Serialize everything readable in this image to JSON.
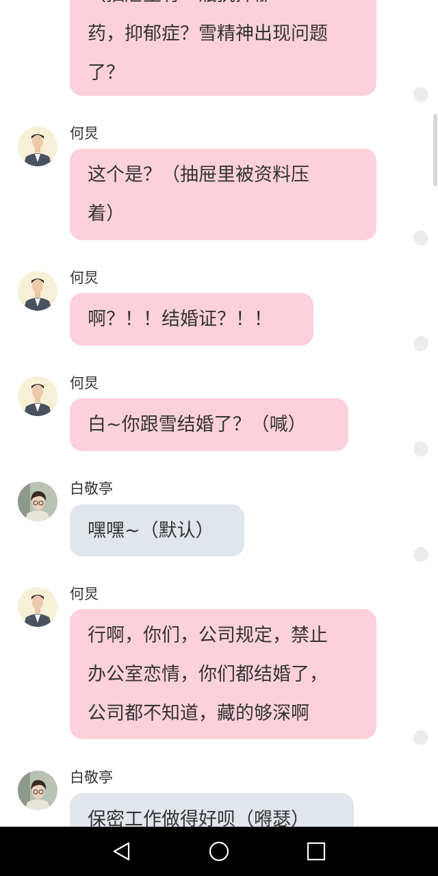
{
  "messages": [
    {
      "sender": "",
      "lines": [
        "（抽屉里有一瓶抗抑郁",
        "药，抑郁症？雪精神出现问题",
        "了？"
      ],
      "avatar": "hezhu-icon",
      "bubble_color": "#fdd1db"
    },
    {
      "sender": "何炅",
      "lines": [
        "这个是？（抽屉里被资料压",
        "着）"
      ],
      "avatar": "hezhu-icon",
      "bubble_color": "#fdd1db"
    },
    {
      "sender": "何炅",
      "lines": [
        "啊？！！结婚证？！！"
      ],
      "avatar": "hezhu-icon",
      "bubble_color": "#fdd1db"
    },
    {
      "sender": "何炅",
      "lines": [
        "白~你跟雪结婚了？（喊）"
      ],
      "avatar": "hezhu-icon",
      "bubble_color": "#fdd1db"
    },
    {
      "sender": "白敬亭",
      "lines": [
        "嘿嘿~（默认）"
      ],
      "avatar": "baijingting-icon",
      "bubble_color": "#e1e5ec"
    },
    {
      "sender": "何炅",
      "lines": [
        "行啊，你们，公司规定，禁止",
        "办公室恋情，你们都结婚了，",
        "公司都不知道，藏的够深啊"
      ],
      "avatar": "hezhu-icon",
      "bubble_color": "#fdd1db"
    },
    {
      "sender": "白敬亭",
      "lines": [
        "保密工作做得好呗（嘚瑟）"
      ],
      "avatar": "baijingting-icon",
      "bubble_color": "#e1e5ec"
    }
  ],
  "navbar": {
    "back_icon": "back-triangle-icon",
    "home_icon": "home-circle-icon",
    "recents_icon": "recents-square-icon"
  },
  "colors": {
    "pink_bubble": "#fdd1db",
    "grey_bubble": "#e1e5ec",
    "navbar": "#000000"
  }
}
